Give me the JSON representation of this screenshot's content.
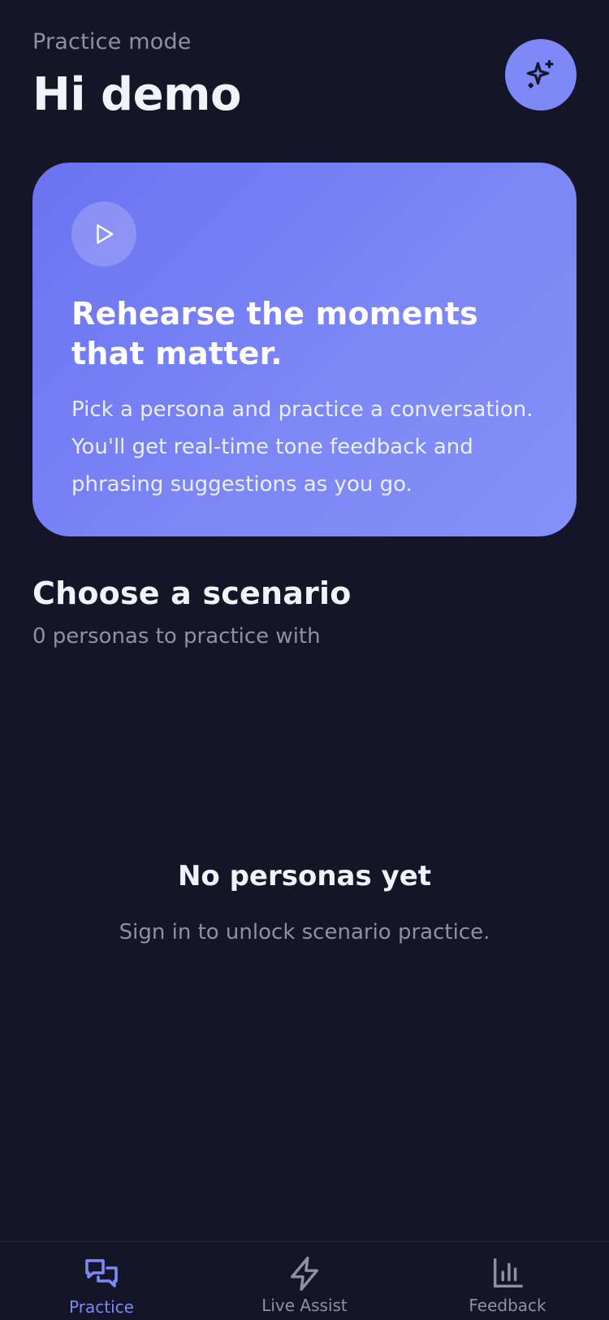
{
  "header": {
    "subtitle": "Practice mode",
    "title": "Hi demo",
    "sparkle_button_icon": "sparkles-icon"
  },
  "hero": {
    "play_icon": "play-icon",
    "heading": "Rehearse the moments that matter.",
    "body": "Pick a persona and practice a conversation. You'll get real-time tone feedback and phrasing suggestions as you go."
  },
  "scenarios": {
    "title": "Choose a scenario",
    "count_text": "0 personas to practice with"
  },
  "empty_state": {
    "title": "No personas yet",
    "subtitle": "Sign in to unlock scenario practice."
  },
  "tabs": [
    {
      "label": "Practice",
      "icon": "chat-bubbles-icon",
      "active": true
    },
    {
      "label": "Live Assist",
      "icon": "lightning-icon",
      "active": false
    },
    {
      "label": "Feedback",
      "icon": "bar-chart-icon",
      "active": false
    }
  ],
  "colors": {
    "background": "#141628",
    "accent": "#7E88F7",
    "muted_text": "#8E90A6",
    "primary_text": "#F2F3F8"
  }
}
